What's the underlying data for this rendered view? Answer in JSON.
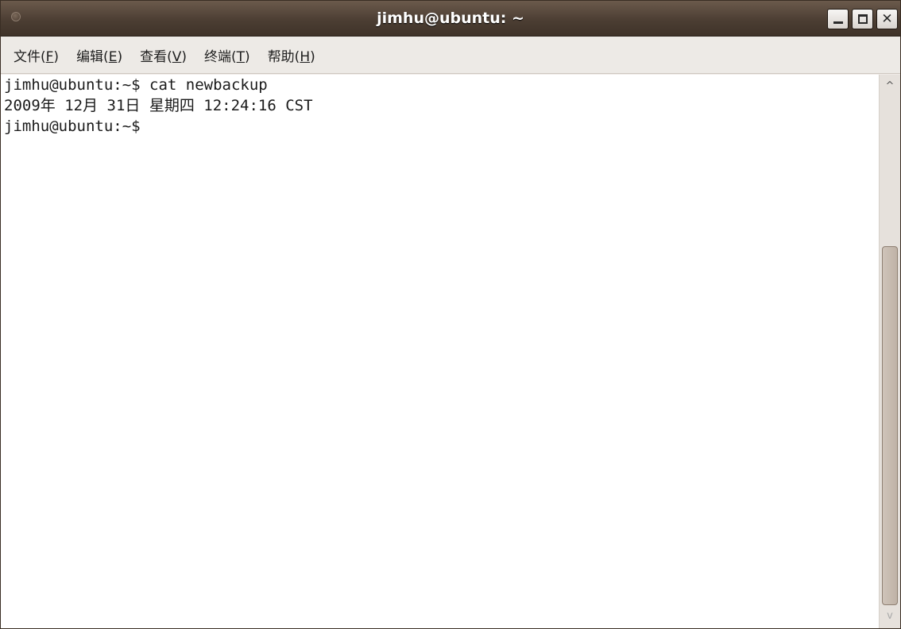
{
  "window": {
    "title": "jimhu@ubuntu: ~",
    "buttons": {
      "minimize": "minimize-icon",
      "maximize": "maximize-icon",
      "close": "close-icon",
      "close_glyph": "✕"
    }
  },
  "menu": {
    "items": [
      {
        "prefix": "文件(",
        "mnemonic": "F",
        "suffix": ")"
      },
      {
        "prefix": "编辑(",
        "mnemonic": "E",
        "suffix": ")"
      },
      {
        "prefix": "查看(",
        "mnemonic": "V",
        "suffix": ")"
      },
      {
        "prefix": "终端(",
        "mnemonic": "T",
        "suffix": ")"
      },
      {
        "prefix": "帮助(",
        "mnemonic": "H",
        "suffix": ")"
      }
    ]
  },
  "terminal": {
    "lines": [
      "jimhu@ubuntu:~$ cat newbackup",
      "2009年 12月 31日 星期四 12:24:16 CST",
      "jimhu@ubuntu:~$"
    ]
  },
  "scrollbar": {
    "up_arrow": "^",
    "down_arrow": "v"
  },
  "colors": {
    "titlebar": "#4c3e33",
    "menubar": "#edeae6",
    "terminal_bg": "#ffffff",
    "terminal_fg": "#1a1a1a"
  }
}
